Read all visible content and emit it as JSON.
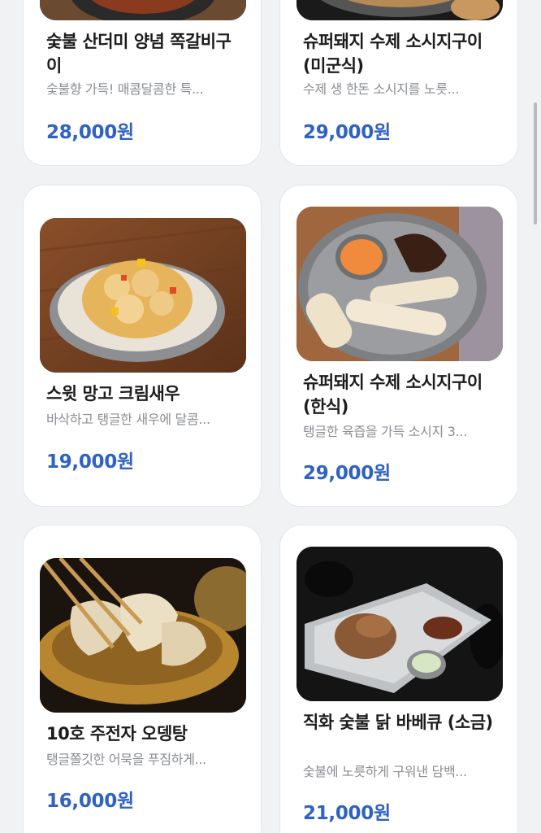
{
  "menu": {
    "items": [
      {
        "title": "숯불 산더미 양념 쪽갈비구이",
        "desc": "숯불향 가득! 매콤달콤한 특...",
        "price": "28,000원",
        "image": "spare-ribs-photo"
      },
      {
        "title": "슈퍼돼지 수제 소시지구이 (미군식)",
        "desc": "수제 생 한돈 소시지를 노릇...",
        "price": "29,000원",
        "image": "sausage-platter-photo"
      },
      {
        "title": "스윗 망고 크림새우",
        "desc": "바삭하고 탱글한 새우에 달콤...",
        "price": "19,000원",
        "image": "mango-cream-shrimp-photo"
      },
      {
        "title": "슈퍼돼지 수제 소시지구이 (한식)",
        "desc": "탱글한 육즙을 가득 소시지 3...",
        "price": "29,000원",
        "image": "sausage-platter-photo"
      },
      {
        "title": "10호 주전자 오뎅탕",
        "desc": "탱글쫄깃한 어묵을 푸짐하게...",
        "price": "16,000원",
        "image": "fish-cake-soup-photo"
      },
      {
        "title": "직화 숯불 닭 바베큐 (소금)",
        "desc": "숯불에 노릇하게 구워낸 담백...",
        "price": "21,000원",
        "image": "chicken-bbq-photo"
      }
    ]
  },
  "colors": {
    "price": "#2f62c4",
    "title": "#1c1c1e",
    "desc": "#8a8d92",
    "background": "#f1f2f4"
  }
}
